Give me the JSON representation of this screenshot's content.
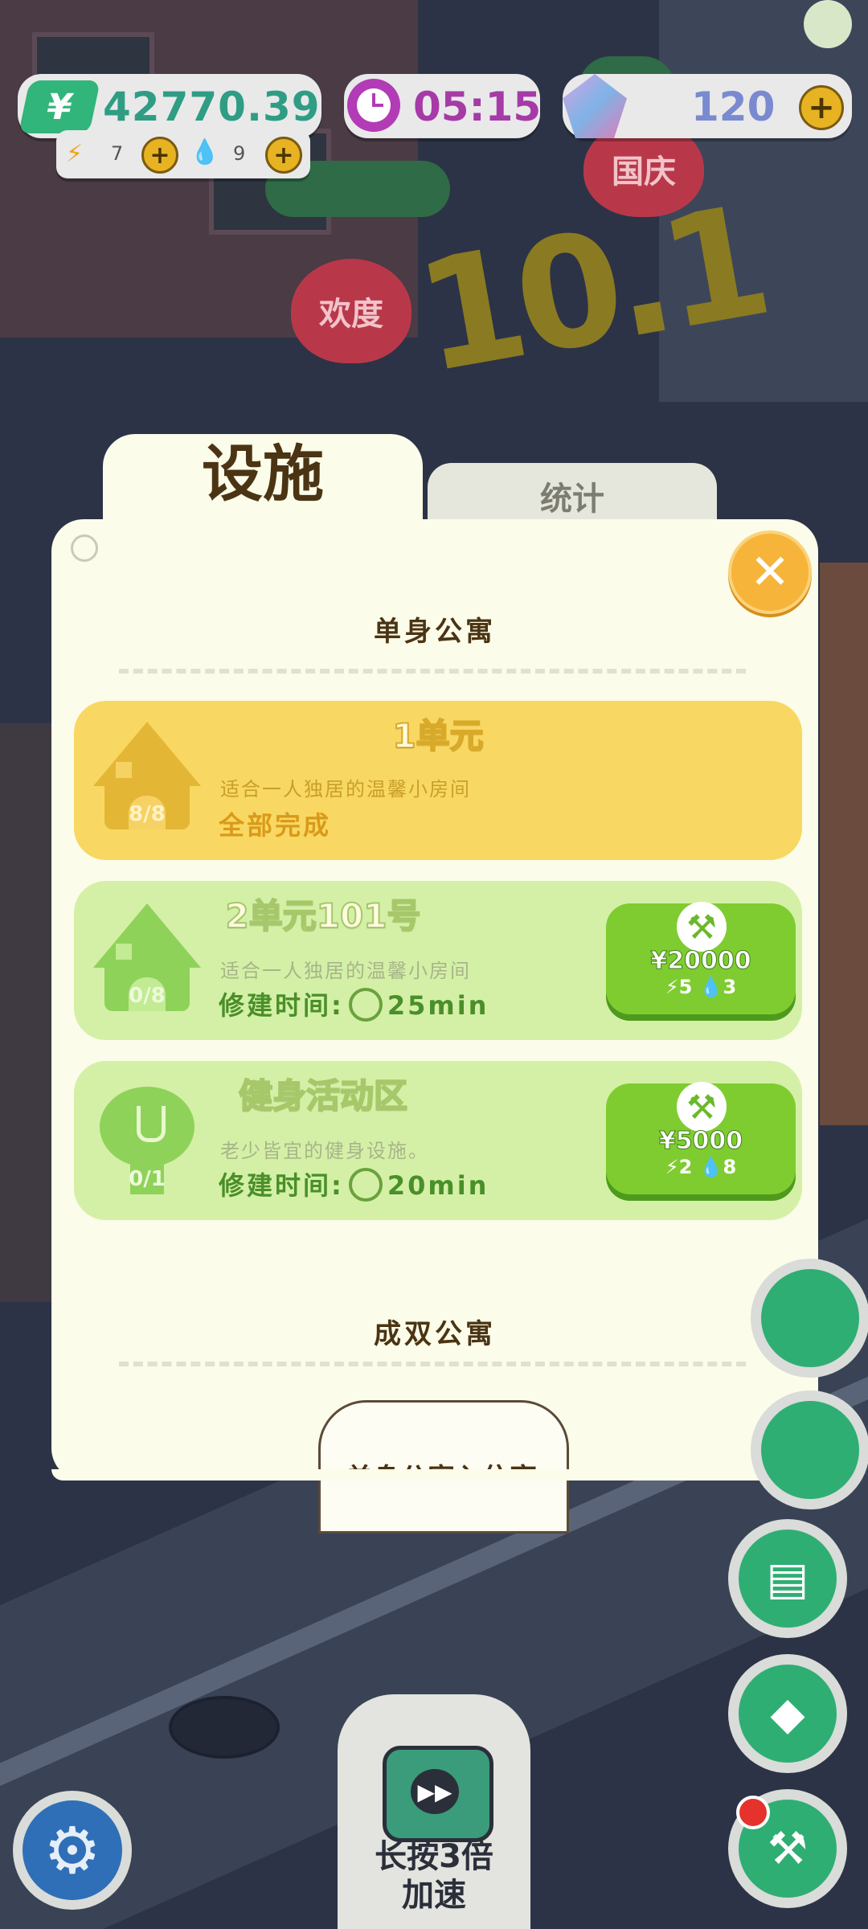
{
  "hud": {
    "money": "42770.39",
    "money_icon": "yen-icon",
    "energy_count": "7",
    "water_count": "9",
    "timer": "05:15",
    "gems": "120"
  },
  "decor": {
    "balloon_left": "欢度",
    "balloon_right": "国庆",
    "big_number": "10.1"
  },
  "tabs": {
    "active": "设施",
    "inactive": "统计"
  },
  "sections": [
    {
      "title": "单身公寓",
      "items": [
        {
          "title": "1单元",
          "progress": "8/8",
          "desc": "适合一人独居的温馨小房间",
          "status": "全部完成",
          "state": "complete",
          "color": "#f8d862"
        },
        {
          "title": "2单元101号",
          "progress": "0/8",
          "desc": "适合一人独居的温馨小房间",
          "build_label": "修建时间:",
          "build_time": "25min",
          "cost_money": "20000",
          "cost_energy": "5",
          "cost_water": "3",
          "state": "buildable",
          "color": "#d4f0a6"
        },
        {
          "title": "健身活动区",
          "progress": "0/1",
          "desc": "老少皆宜的健身设施。",
          "build_label": "修建时间:",
          "build_time": "20min",
          "cost_money": "5000",
          "cost_energy": "2",
          "cost_water": "8",
          "state": "buildable",
          "color": "#d4f0a6"
        }
      ]
    },
    {
      "title": "成双公寓",
      "locked_label": "单身公寓入住率"
    }
  ],
  "speed_button": {
    "label": "长按3倍\n加速"
  },
  "colors": {
    "accent_green": "#7fcc31",
    "panel_bg": "#fbfce9",
    "close_orange": "#f6b43a",
    "money_green": "#32b57a",
    "timer_purple": "#b23bb6"
  }
}
